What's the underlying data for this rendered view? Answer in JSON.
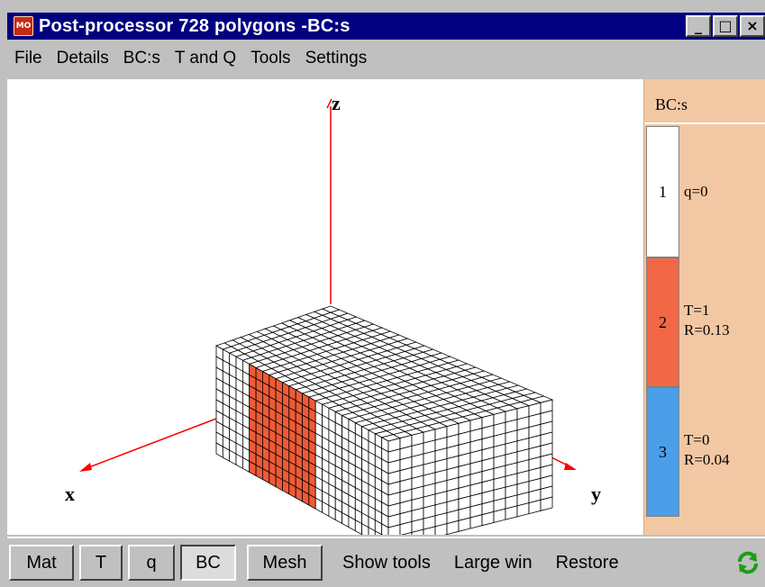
{
  "window": {
    "title": "Post-processor 728 polygons  -BC:s",
    "icon": "MO",
    "controls": [
      "_",
      "□",
      "×"
    ]
  },
  "menu": [
    "File",
    "Details",
    "BC:s",
    "T and Q",
    "Tools",
    "Settings"
  ],
  "axes": {
    "x": "x",
    "y": "y",
    "z": "z"
  },
  "colors": {
    "bc1": "#ffffff",
    "bc2": "#f26846",
    "bc3": "#4a9fe8",
    "panel": "#f2c8a4",
    "axis": "#ff0000",
    "selected_face": "#f05a36"
  },
  "bc_panel": {
    "title": "BC:s",
    "items": [
      {
        "number": "1",
        "lines": [
          "q=0"
        ]
      },
      {
        "number": "2",
        "lines": [
          "T=1",
          "R=0.13"
        ]
      },
      {
        "number": "3",
        "lines": [
          "T=0",
          "R=0.04"
        ]
      }
    ]
  },
  "toolbar": {
    "mat": "Mat",
    "t": "T",
    "q": "q",
    "bc": "BC",
    "mesh": "Mesh",
    "show_tools": "Show tools",
    "large_win": "Large win",
    "restore": "Restore",
    "refresh_icon": "refresh-icon"
  }
}
